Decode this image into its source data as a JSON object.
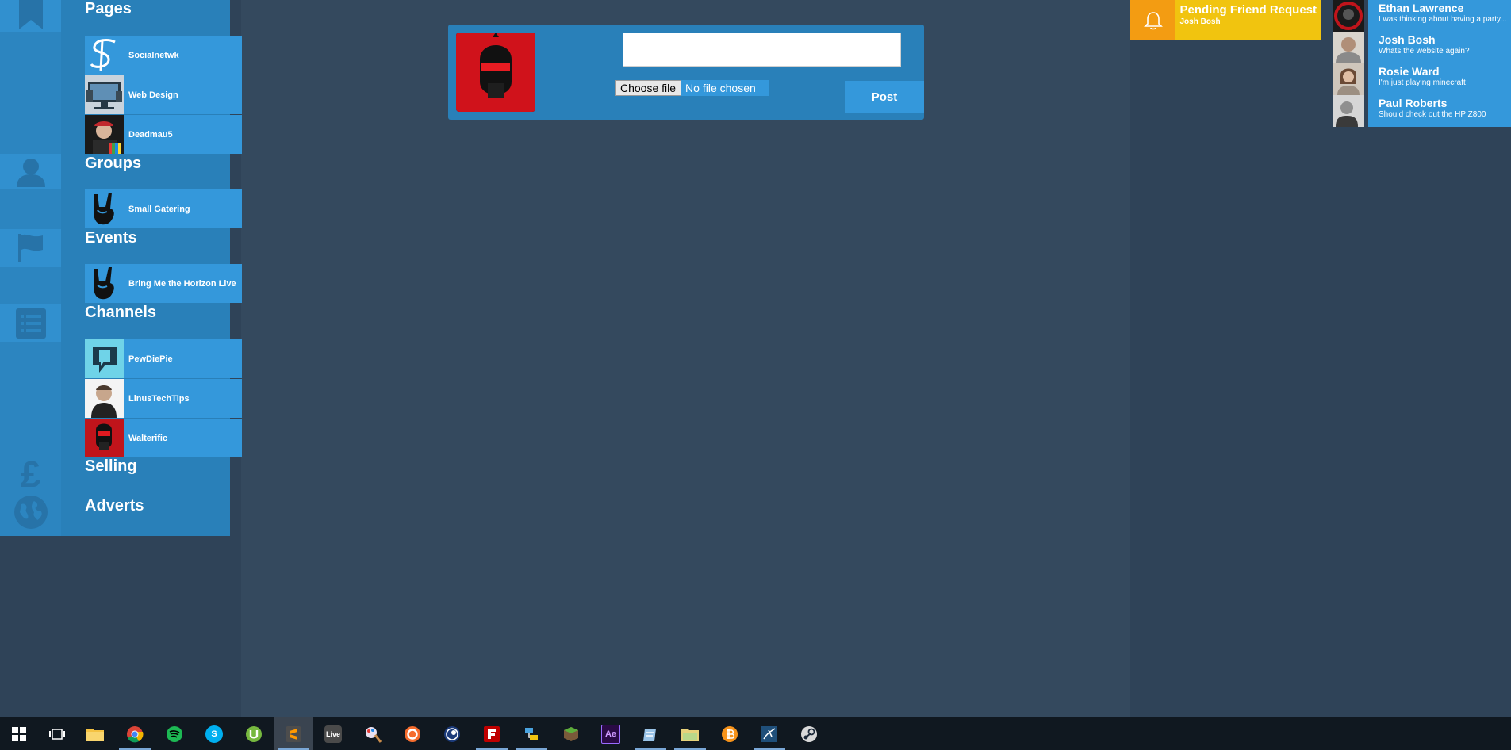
{
  "colors": {
    "background": "#34495e",
    "panel": "#2f4358",
    "sidebar": "#2980b9",
    "item": "#3498db",
    "notif_accent": "#f39c12",
    "notif": "#f1c40f",
    "taskbar": "#101820"
  },
  "sidebar": {
    "sections": [
      {
        "title": "Pages",
        "icon": "bookmark-icon",
        "items": [
          {
            "label": "Socialnetwk",
            "thumb": "socialnetwk-logo"
          },
          {
            "label": "Web Design",
            "thumb": "web-design-thumb"
          },
          {
            "label": "Deadmau5",
            "thumb": "deadmau5-thumb"
          }
        ]
      },
      {
        "title": "Groups",
        "icon": "user-icon",
        "items": [
          {
            "label": "Small Gatering",
            "thumb": "rock-hand-thumb"
          }
        ]
      },
      {
        "title": "Events",
        "icon": "flag-icon",
        "items": [
          {
            "label": "Bring Me the Horizon Live",
            "thumb": "rock-hand-thumb"
          }
        ]
      },
      {
        "title": "Channels",
        "icon": "list-icon",
        "items": [
          {
            "label": "PewDiePie",
            "thumb": "pewdiepie-thumb"
          },
          {
            "label": "LinusTechTips",
            "thumb": "linustechtips-thumb"
          },
          {
            "label": "Walterific",
            "thumb": "walterific-thumb"
          }
        ]
      },
      {
        "title": "Selling",
        "icon": "pound-icon",
        "items": []
      },
      {
        "title": "Adverts",
        "icon": "globe-icon",
        "items": []
      }
    ]
  },
  "post": {
    "input_value": "",
    "choose_file_label": "Choose file",
    "file_status": "No file chosen",
    "post_label": "Post"
  },
  "notification": {
    "icon": "bell-icon",
    "title": "Pending Friend Request",
    "subtitle": "Josh Bosh"
  },
  "chats": [
    {
      "name": "Ethan Lawrence",
      "message": "I was thinking about having a party..."
    },
    {
      "name": "Josh Bosh",
      "message": "Whats the website again?"
    },
    {
      "name": "Rosie Ward",
      "message": "I'm just playing minecraft"
    },
    {
      "name": "Paul Roberts",
      "message": "Should check out the HP Z800"
    }
  ],
  "taskbar": {
    "items": [
      {
        "name": "windows-start",
        "label": ""
      },
      {
        "name": "task-view",
        "label": ""
      },
      {
        "name": "file-explorer",
        "label": ""
      },
      {
        "name": "chrome",
        "label": ""
      },
      {
        "name": "spotify",
        "label": ""
      },
      {
        "name": "skype",
        "label": "S"
      },
      {
        "name": "utorrent",
        "label": ""
      },
      {
        "name": "sublime-text",
        "label": ""
      },
      {
        "name": "ableton-live",
        "label": "Live"
      },
      {
        "name": "paint-app",
        "label": ""
      },
      {
        "name": "origin",
        "label": ""
      },
      {
        "name": "cinema4d",
        "label": ""
      },
      {
        "name": "filezilla",
        "label": ""
      },
      {
        "name": "network-tool",
        "label": ""
      },
      {
        "name": "minecraft",
        "label": ""
      },
      {
        "name": "after-effects",
        "label": "Ae"
      },
      {
        "name": "notes-app",
        "label": ""
      },
      {
        "name": "folder-app",
        "label": ""
      },
      {
        "name": "bitcoin",
        "label": ""
      },
      {
        "name": "mysql-workbench",
        "label": ""
      },
      {
        "name": "steam",
        "label": ""
      }
    ]
  }
}
